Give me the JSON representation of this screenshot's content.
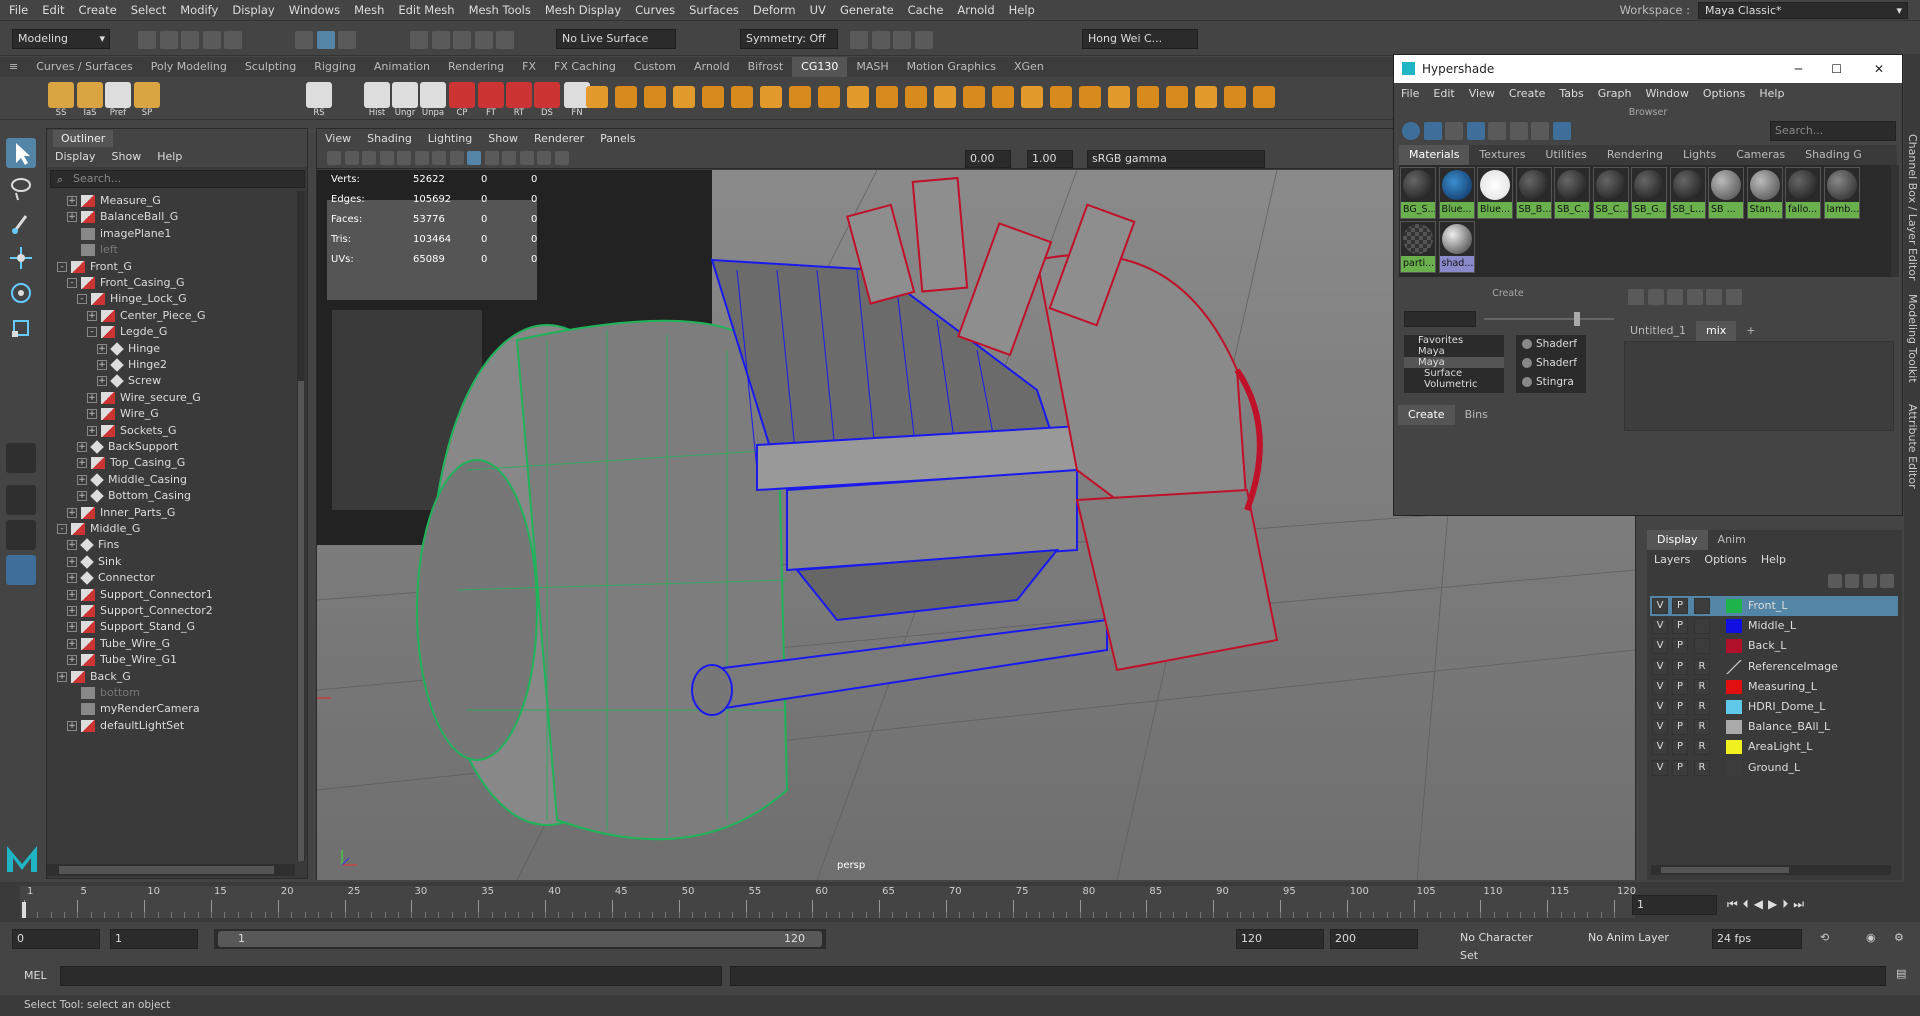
{
  "menubar": {
    "items": [
      "File",
      "Edit",
      "Create",
      "Select",
      "Modify",
      "Display",
      "Windows",
      "Mesh",
      "Edit Mesh",
      "Mesh Tools",
      "Mesh Display",
      "Curves",
      "Surfaces",
      "Deform",
      "UV",
      "Generate",
      "Cache",
      "Arnold",
      "Help"
    ],
    "workspace_label": "Workspace :",
    "workspace_value": "Maya Classic*"
  },
  "status": {
    "mode": "Modeling",
    "live_surface": "No Live Surface",
    "symmetry": "Symmetry: Off",
    "user": "Hong Wei C..."
  },
  "shelf": {
    "tabs": [
      "Curves / Surfaces",
      "Poly Modeling",
      "Sculpting",
      "Rigging",
      "Animation",
      "Rendering",
      "FX",
      "FX Caching",
      "Custom",
      "Arnold",
      "Bifrost",
      "CG130",
      "MASH",
      "Motion Graphics",
      "XGen"
    ],
    "active_tab": "CG130",
    "labels": [
      "SS",
      "IaS",
      "Pref",
      "SP",
      "RS",
      "Hist",
      "Ungr",
      "Unpa",
      "CP",
      "FT",
      "RT",
      "DS",
      "FN"
    ]
  },
  "outliner": {
    "title": "Outliner",
    "menu": [
      "Display",
      "Show",
      "Help"
    ],
    "search_placeholder": "Search...",
    "items": [
      {
        "label": "Measure_G",
        "indent": 1,
        "type": "grp",
        "exp": "+"
      },
      {
        "label": "BalanceBall_G",
        "indent": 1,
        "type": "grp",
        "exp": "+"
      },
      {
        "label": "imagePlane1",
        "indent": 1,
        "type": "cam",
        "exp": ""
      },
      {
        "label": "left",
        "indent": 1,
        "type": "cam",
        "exp": "",
        "dim": true
      },
      {
        "label": "Front_G",
        "indent": 0,
        "type": "grp",
        "exp": "-"
      },
      {
        "label": "Front_Casing_G",
        "indent": 1,
        "type": "grp",
        "exp": "-"
      },
      {
        "label": "Hinge_Lock_G",
        "indent": 2,
        "type": "grp",
        "exp": "-"
      },
      {
        "label": "Center_Piece_G",
        "indent": 3,
        "type": "grp",
        "exp": "+"
      },
      {
        "label": "Legde_G",
        "indent": 3,
        "type": "grp",
        "exp": "-"
      },
      {
        "label": "Hinge",
        "indent": 4,
        "type": "mesh",
        "exp": "+"
      },
      {
        "label": "Hinge2",
        "indent": 4,
        "type": "mesh",
        "exp": "+"
      },
      {
        "label": "Screw",
        "indent": 4,
        "type": "mesh",
        "exp": "+"
      },
      {
        "label": "Wire_secure_G",
        "indent": 3,
        "type": "grp",
        "exp": "+"
      },
      {
        "label": "Wire_G",
        "indent": 3,
        "type": "grp",
        "exp": "+"
      },
      {
        "label": "Sockets_G",
        "indent": 3,
        "type": "grp",
        "exp": "+"
      },
      {
        "label": "BackSupport",
        "indent": 2,
        "type": "mesh",
        "exp": "+"
      },
      {
        "label": "Top_Casing_G",
        "indent": 2,
        "type": "grp",
        "exp": "+"
      },
      {
        "label": "Middle_Casing",
        "indent": 2,
        "type": "mesh",
        "exp": "+"
      },
      {
        "label": "Bottom_Casing",
        "indent": 2,
        "type": "mesh",
        "exp": "+"
      },
      {
        "label": "Inner_Parts_G",
        "indent": 1,
        "type": "grp",
        "exp": "+"
      },
      {
        "label": "Middle_G",
        "indent": 0,
        "type": "grp",
        "exp": "-"
      },
      {
        "label": "Fins",
        "indent": 1,
        "type": "mesh",
        "exp": "+"
      },
      {
        "label": "Sink",
        "indent": 1,
        "type": "mesh",
        "exp": "+"
      },
      {
        "label": "Connector",
        "indent": 1,
        "type": "mesh",
        "exp": "+"
      },
      {
        "label": "Support_Connector1",
        "indent": 1,
        "type": "grp",
        "exp": "+"
      },
      {
        "label": "Support_Connector2",
        "indent": 1,
        "type": "grp",
        "exp": "+"
      },
      {
        "label": "Support_Stand_G",
        "indent": 1,
        "type": "grp",
        "exp": "+"
      },
      {
        "label": "Tube_Wire_G",
        "indent": 1,
        "type": "grp",
        "exp": "+"
      },
      {
        "label": "Tube_Wire_G1",
        "indent": 1,
        "type": "grp",
        "exp": "+"
      },
      {
        "label": "Back_G",
        "indent": 0,
        "type": "grp",
        "exp": "+"
      },
      {
        "label": "bottom",
        "indent": 1,
        "type": "cam",
        "exp": "",
        "dim": true
      },
      {
        "label": "myRenderCamera",
        "indent": 1,
        "type": "cam",
        "exp": ""
      },
      {
        "label": "defaultLightSet",
        "indent": 1,
        "type": "grp",
        "exp": "+"
      }
    ]
  },
  "viewport": {
    "menu": [
      "View",
      "Shading",
      "Lighting",
      "Show",
      "Renderer",
      "Panels"
    ],
    "exposure": "0.00",
    "gamma": "1.00",
    "colorspace": "sRGB gamma",
    "camera": "persp",
    "hud": [
      {
        "k": "Verts:",
        "v": "52622",
        "a": "0",
        "b": "0"
      },
      {
        "k": "Edges:",
        "v": "105692",
        "a": "0",
        "b": "0"
      },
      {
        "k": "Faces:",
        "v": "53776",
        "a": "0",
        "b": "0"
      },
      {
        "k": "Tris:",
        "v": "103464",
        "a": "0",
        "b": "0"
      },
      {
        "k": "UVs:",
        "v": "65089",
        "a": "0",
        "b": "0"
      }
    ]
  },
  "hypershade": {
    "title": "Hypershade",
    "menu": [
      "File",
      "Edit",
      "View",
      "Create",
      "Tabs",
      "Graph",
      "Window",
      "Options",
      "Help"
    ],
    "browser_label": "Browser",
    "search_placeholder": "Search...",
    "tabs": [
      "Materials",
      "Textures",
      "Utilities",
      "Rendering",
      "Lights",
      "Cameras",
      "Shading G"
    ],
    "materials": [
      "BG_S...",
      "Blue...",
      "Blue...",
      "SB_B...",
      "SB_C...",
      "SB_C...",
      "SB_G...",
      "SB_L...",
      "SB ...",
      "Stan...",
      "fallo...",
      "lamb...",
      "parti...",
      "shad..."
    ],
    "create_label": "Create",
    "tree": [
      "Favorites",
      "Maya",
      "Maya",
      "Surface",
      "Volumetric"
    ],
    "shaders": [
      "Shaderf",
      "Shaderf",
      "Stingra"
    ],
    "bottom_tabs": [
      "Create",
      "Bins"
    ],
    "graph_tabs": [
      "Untitled_1",
      "mix",
      "+"
    ]
  },
  "layers": {
    "tabs": [
      "Display",
      "Anim"
    ],
    "menu": [
      "Layers",
      "Options",
      "Help"
    ],
    "rows": [
      {
        "v": "V",
        "p": "P",
        "r": "",
        "name": "Front_L",
        "color": "#1db34a",
        "sel": true
      },
      {
        "v": "V",
        "p": "P",
        "r": "",
        "name": "Middle_L",
        "color": "#1010e0"
      },
      {
        "v": "V",
        "p": "P",
        "r": "",
        "name": "Back_L",
        "color": "#b0102a"
      },
      {
        "v": "V",
        "p": "P",
        "r": "R",
        "name": "ReferenceImage",
        "color": ""
      },
      {
        "v": "V",
        "p": "P",
        "r": "R",
        "name": "Measuring_L",
        "color": "#e01010"
      },
      {
        "v": "V",
        "p": "P",
        "r": "R",
        "name": "HDRI_Dome_L",
        "color": "#60c8e8"
      },
      {
        "v": "V",
        "p": "P",
        "r": "R",
        "name": "Balance_BAll_L",
        "color": "#aaaaaa"
      },
      {
        "v": "V",
        "p": "P",
        "r": "R",
        "name": "AreaLight_L",
        "color": "#f0f020"
      },
      {
        "v": "V",
        "p": "P",
        "r": "R",
        "name": "Ground_L",
        "color": "#3c3c3c"
      }
    ]
  },
  "sidetabs": [
    "Channel Box / Layer Editor",
    "Modeling Toolkit",
    "Attribute Editor"
  ],
  "timeline": {
    "ticks": [
      "1",
      "5",
      "10",
      "15",
      "20",
      "25",
      "30",
      "35",
      "40",
      "45",
      "50",
      "55",
      "60",
      "65",
      "70",
      "75",
      "80",
      "85",
      "90",
      "95",
      "100",
      "105",
      "110",
      "115",
      "120"
    ],
    "current": "1"
  },
  "range": {
    "start": "0",
    "play_start": "1",
    "slider_start": "1",
    "slider_end": "120",
    "play_end": "120",
    "end": "200",
    "char_set": "No Character Set",
    "anim_layer": "No Anim Layer",
    "fps": "24 fps"
  },
  "cmd": {
    "label": "MEL"
  },
  "help": {
    "text": "Select Tool: select an object"
  }
}
